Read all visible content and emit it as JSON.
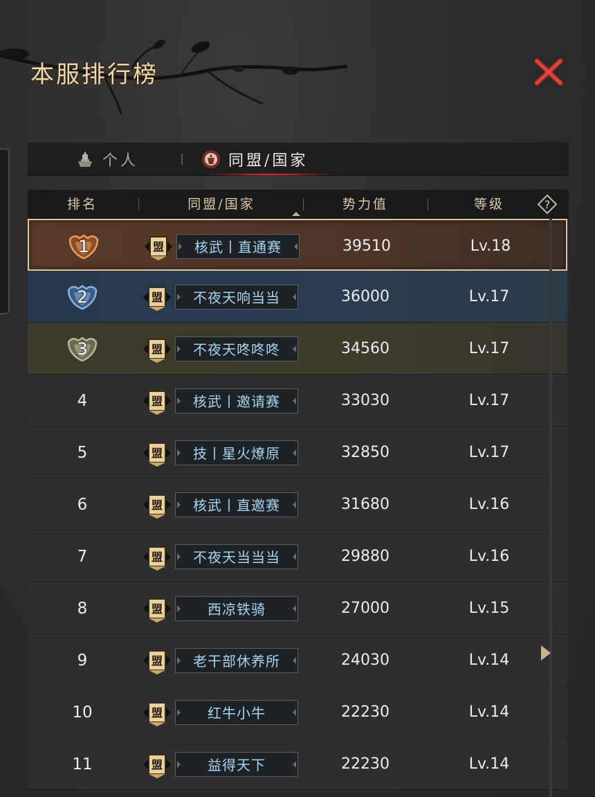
{
  "title": "本服排行榜",
  "tabs": [
    {
      "label": "个人",
      "icon": "person-icon",
      "active": false
    },
    {
      "label": "同盟/国家",
      "icon": "alliance-icon",
      "active": true
    }
  ],
  "table": {
    "headers": [
      "排名",
      "同盟/国家",
      "势力值",
      "等级"
    ],
    "badge_char": "盟",
    "rows": [
      {
        "rank": "1",
        "name": "核武丨直通赛",
        "power": "39510",
        "level": "Lv.18"
      },
      {
        "rank": "2",
        "name": "不夜天响当当",
        "power": "36000",
        "level": "Lv.17"
      },
      {
        "rank": "3",
        "name": "不夜天咚咚咚",
        "power": "34560",
        "level": "Lv.17"
      },
      {
        "rank": "4",
        "name": "核武丨邀请赛",
        "power": "33030",
        "level": "Lv.17"
      },
      {
        "rank": "5",
        "name": "技丨星火燎原",
        "power": "32850",
        "level": "Lv.17"
      },
      {
        "rank": "6",
        "name": "核武丨直邀赛",
        "power": "31680",
        "level": "Lv.16"
      },
      {
        "rank": "7",
        "name": "不夜天当当当",
        "power": "29880",
        "level": "Lv.16"
      },
      {
        "rank": "8",
        "name": "西凉铁骑",
        "power": "27000",
        "level": "Lv.15"
      },
      {
        "rank": "9",
        "name": "老干部休养所",
        "power": "24030",
        "level": "Lv.14"
      },
      {
        "rank": "10",
        "name": "红牛小牛",
        "power": "22230",
        "level": "Lv.14"
      },
      {
        "rank": "11",
        "name": "益得天下",
        "power": "22230",
        "level": "Lv.14"
      }
    ]
  },
  "colors": {
    "title": "#f0d9a8",
    "close": "#c8312c",
    "alliance_name": "#a8d4f0",
    "rank1_bg": "#5a3a28",
    "rank2_bg": "#26394d",
    "rank3_bg": "#3c3a2b"
  }
}
